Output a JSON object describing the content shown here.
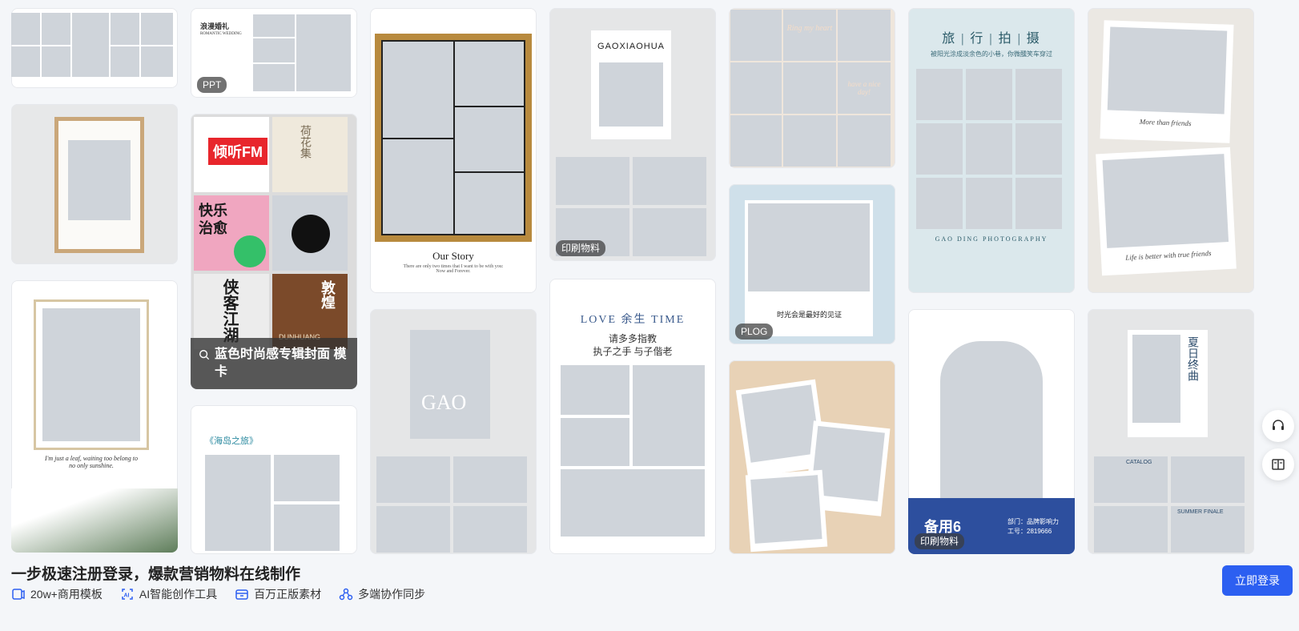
{
  "gallery": {
    "tags": {
      "ppt": "PPT",
      "print1": "印刷物料",
      "plog": "PLOG",
      "print2": "印刷物料",
      "print3": "印刷物料"
    },
    "covers": {
      "wedding_title": "浪漫婚礼",
      "wedding_sub": "ROMANTIC WEDDING",
      "our_story": "Our Story",
      "our_story_sub": "There are only two times that I want to be with you: Now and Forever.",
      "gaoxiaohua": "GAOXIAOHUA",
      "ring_text": "Ring my heart",
      "nice_day": "have a nice day!",
      "travel_title": "旅 | 行 | 拍 | 摄",
      "travel_sub": "被阳光涂成淡余色的小巷，你微醺笑车穿过",
      "travel_footer": "GAO DING PHOTOGRAPHY",
      "friends_1": "More than friends",
      "friends_2": "Life is better with true friends",
      "leaf_text": "I'm just a leaf, waiting too belong to no only sunshine.",
      "music_fm": "倾听FM",
      "music_lotus": "荷花集",
      "music_happy": "快乐治愈",
      "music_xia": "侠客江湖",
      "music_dunhuang": "敦煌",
      "dunhuang_en": "DUNHUANG",
      "island": "《海岛之旅》",
      "gao": "GAO",
      "love_time": "LOVE 余生 TIME",
      "love_line1": "请多多指教",
      "love_line2": "执子之手  与子偕老",
      "plog_caption": "时光会是最好的见证",
      "summer": "夏日终曲",
      "catalog": "CATALOG",
      "summer_finale": "SUMMER FINALE",
      "badge_name": "备用6",
      "badge_dept": "部门：品牌影响力",
      "badge_no": "工号：2819666"
    },
    "search_overlay": "蓝色时尚感专辑封面 模卡"
  },
  "footer": {
    "headline": "一步极速注册登录，爆款营销物料在线制作",
    "features": [
      {
        "icon": "template-icon",
        "label": "20w+商用模板"
      },
      {
        "icon": "ai-icon",
        "label": "AI智能创作工具"
      },
      {
        "icon": "asset-icon",
        "label": "百万正版素材"
      },
      {
        "icon": "collab-icon",
        "label": "多端协作同步"
      }
    ],
    "login_label": "立即登录"
  },
  "colors": {
    "accent": "#2c5ff1",
    "page_bg": "#f4f6f9"
  }
}
